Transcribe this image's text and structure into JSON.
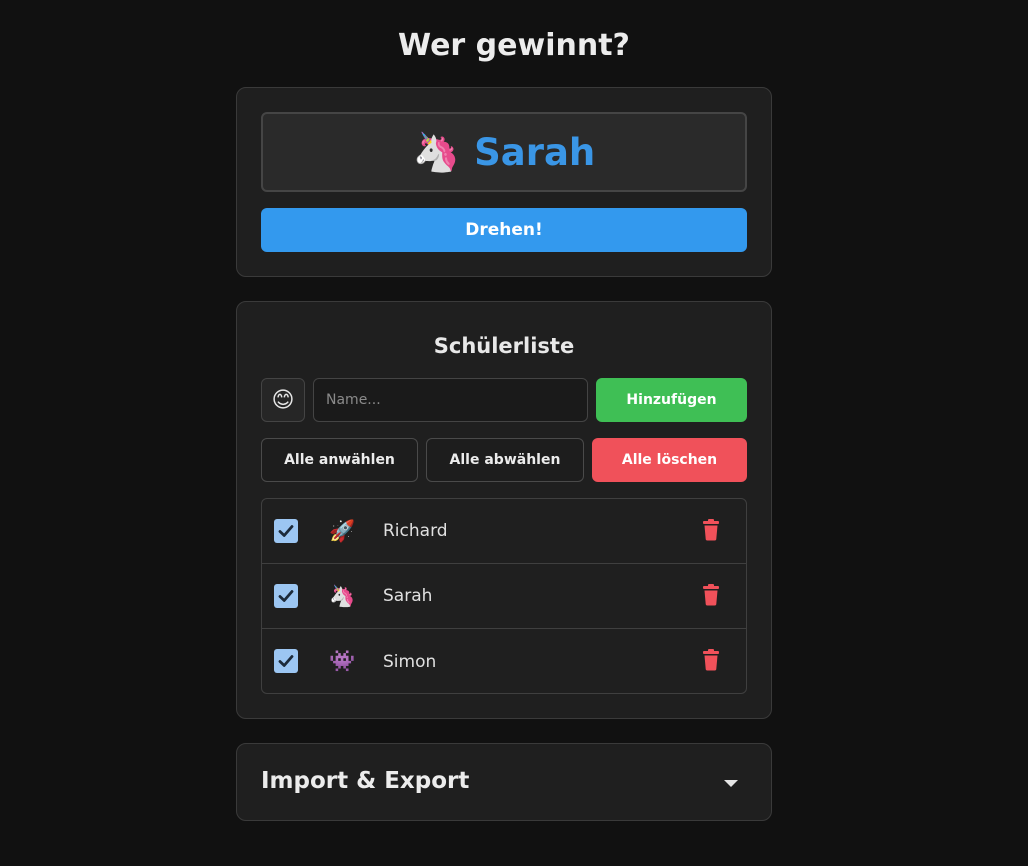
{
  "app": {
    "title": "Wer gewinnt?"
  },
  "winner": {
    "emoji": "🦄",
    "name": "Sarah",
    "spin_label": "Drehen!"
  },
  "students": {
    "heading": "Schülerliste",
    "emoji_picker": "😊",
    "name_placeholder": "Name...",
    "add_label": "Hinzufügen",
    "select_all_label": "Alle anwählen",
    "deselect_all_label": "Alle abwählen",
    "delete_all_label": "Alle löschen",
    "items": [
      {
        "emoji": "🚀",
        "name": "Richard",
        "checked": true
      },
      {
        "emoji": "🦄",
        "name": "Sarah",
        "checked": true
      },
      {
        "emoji": "👾",
        "name": "Simon",
        "checked": true
      }
    ]
  },
  "import_export": {
    "title": "Import & Export",
    "expanded": false
  },
  "colors": {
    "accent": "#3399ee",
    "winner_name": "#3a96e6",
    "add": "#3fbf55",
    "danger": "#f0515a",
    "checkbox": "#9cc6f2"
  }
}
